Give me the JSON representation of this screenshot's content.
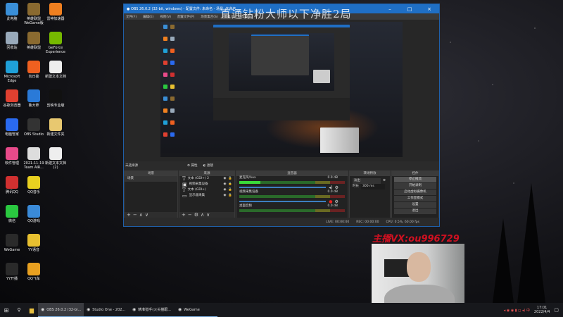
{
  "desktop_icons": [
    {
      "label": "此电脑",
      "color": "#3a8fd8"
    },
    {
      "label": "英雄联盟WeGame版",
      "color": "#8a6a30"
    },
    {
      "label": "雷神加速器",
      "color": "#f08020"
    },
    {
      "label": "回收站",
      "color": "#9ab"
    },
    {
      "label": "英雄联盟",
      "color": "#8a6a30"
    },
    {
      "label": "GeForce Experience",
      "color": "#76b900"
    },
    {
      "label": "Microsoft Edge",
      "color": "#1fa0d8"
    },
    {
      "label": "向日葵",
      "color": "#f06020"
    },
    {
      "label": "新建文本文档",
      "color": "#eee"
    },
    {
      "label": "谷歌浏览器",
      "color": "#e04030"
    },
    {
      "label": "鲁大师",
      "color": "#2a7ad8"
    },
    {
      "label": "剪映专业版",
      "color": "#111"
    },
    {
      "label": "电脑管家",
      "color": "#2a6af0"
    },
    {
      "label": "OBS Studio",
      "color": "#333"
    },
    {
      "label": "新建文件夹",
      "color": "#e8c870"
    },
    {
      "label": "软件管理",
      "color": "#e84a8a"
    },
    {
      "label": "2021-11-19 Team AIR...",
      "color": "#ddd"
    },
    {
      "label": "新建文本文档 (2)",
      "color": "#eee"
    },
    {
      "label": "腾讯QQ",
      "color": "#d03030"
    },
    {
      "label": "QQ音乐",
      "color": "#e8d020"
    },
    {
      "label": "微信",
      "color": "#2ac840"
    },
    {
      "label": "QQ游戏",
      "color": "#3a8ad8"
    },
    {
      "label": "WeGame",
      "color": "#2a2a2a"
    },
    {
      "label": "YY语音",
      "color": "#e8c030"
    },
    {
      "label": "YY开播",
      "color": "#2a2a2a"
    },
    {
      "label": "QQ飞车",
      "color": "#e8a020"
    }
  ],
  "obs": {
    "title": "OBS 26.0.2 (32-bit, windows) - 配置文件: 未命名 - 场景: 未命名",
    "menu": [
      "文件(F)",
      "编辑(E)",
      "视图(V)",
      "配置文件(P)",
      "场景集合(S)",
      "工具(T)",
      "帮助(H)"
    ],
    "context": {
      "no_source": "未选择源",
      "properties": "属性",
      "filters": "滤镜"
    },
    "docks": {
      "scenes": "场景",
      "sources": "来源",
      "mixer": "混音器",
      "transitions": "转场特效",
      "controls": "控件"
    },
    "scenes": [
      "场景"
    ],
    "sources": [
      {
        "icon": "text-icon",
        "name": "文本 (GDI+) 2"
      },
      {
        "icon": "camera-icon",
        "name": "视频采集设备"
      },
      {
        "icon": "text-icon",
        "name": "文本 (GDI+)"
      },
      {
        "icon": "monitor-icon",
        "name": "显示器采集"
      }
    ],
    "mixer": [
      {
        "name": "麦克风/Aux",
        "db": "0.0 dB",
        "level": 0.2,
        "muted": false
      },
      {
        "name": "视频采集设备",
        "db": "0.0 dB",
        "level": 0,
        "muted": true
      },
      {
        "name": "桌面音频",
        "db": "0.0 dB",
        "level": 0,
        "muted": false
      }
    ],
    "transition": {
      "type": "淡出",
      "duration_label": "时长",
      "duration": "300 ms"
    },
    "controls": [
      "停止推流",
      "开始录制",
      "启动虚拟摄像机",
      "工作室模式",
      "设置",
      "退出"
    ],
    "status": {
      "live": "LIVE: 00:00:00",
      "rec": "REC: 00:00:00",
      "cpu": "CPU: 0.5%, 60.00 fps"
    }
  },
  "overlay": {
    "title": "直通钻粉大师以下净胜2局",
    "caption": "主播VX:ou996729"
  },
  "taskbar": {
    "items": [
      "OBS 26.0.2 (32-bi...",
      "Studio One - 202...",
      "精准猎手(火头猫跟...",
      "WeGame"
    ],
    "time": "17:01",
    "date": "2022/4/4"
  }
}
